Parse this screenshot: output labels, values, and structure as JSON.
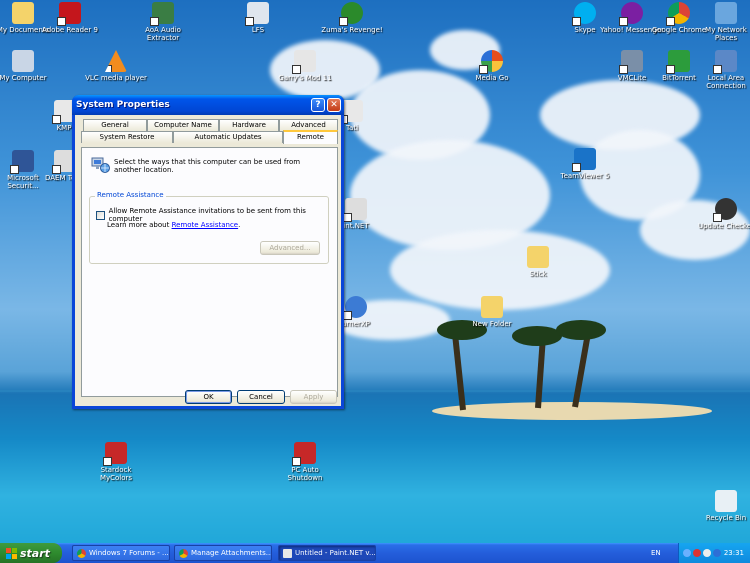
{
  "desktop": {
    "icons": [
      {
        "label": "My Documents",
        "icon": "folder-documents-icon",
        "color": "#f4d36a"
      },
      {
        "label": "Adobe Reader 9",
        "icon": "adobe-reader-icon",
        "color": "#c4161c"
      },
      {
        "label": "AoA Audio Extractor",
        "icon": "audio-extractor-icon",
        "color": "#3a7d44"
      },
      {
        "label": "LFS",
        "icon": "lfs-icon",
        "color": "#dfe6ee"
      },
      {
        "label": "Zuma's Revenge!",
        "icon": "zuma-icon",
        "color": "#2b8a2b"
      },
      {
        "label": "Skype",
        "icon": "skype-icon",
        "color": "#00aff0"
      },
      {
        "label": "Yahoo! Messenger",
        "icon": "yahoo-messenger-icon",
        "color": "#7b1fa2"
      },
      {
        "label": "Google Chrome",
        "icon": "chrome-icon",
        "color": "#4caf50"
      },
      {
        "label": "My Network Places",
        "icon": "network-places-icon",
        "color": "#6aa6de"
      },
      {
        "label": "My Computer",
        "icon": "computer-icon",
        "color": "#c9d6e6"
      },
      {
        "label": "VLC media player",
        "icon": "vlc-icon",
        "color": "#f28c1e"
      },
      {
        "label": "Garry's Mod 11",
        "icon": "garrys-mod-icon",
        "color": "#e6e6e6"
      },
      {
        "label": "Media Go",
        "icon": "media-go-icon",
        "color": "#e84e1c"
      },
      {
        "label": "VMCLite",
        "icon": "vmclite-icon",
        "color": "#7a8fa8"
      },
      {
        "label": "BitTorrent",
        "icon": "bittorrent-icon",
        "color": "#2c9c3c"
      },
      {
        "label": "Local Area Connection",
        "icon": "lan-icon",
        "color": "#5b88c7"
      },
      {
        "label": "KMPl",
        "icon": "kmplayer-icon",
        "color": "#e8e8e8"
      },
      {
        "label": "Tati",
        "icon": "tati-icon",
        "color": "#e8e8e8"
      },
      {
        "label": "Microsoft Securit...",
        "icon": "security-icon",
        "color": "#2f5597"
      },
      {
        "label": "DAEM Tools",
        "icon": "daemon-tools-icon",
        "color": "#ddd"
      },
      {
        "label": "TeamViewer 5",
        "icon": "teamviewer-icon",
        "color": "#1a73c8"
      },
      {
        "label": "Update Checker",
        "icon": "update-checker-icon",
        "color": "#333"
      },
      {
        "label": "int.NET",
        "icon": "paintnet-icon",
        "color": "#ddd"
      },
      {
        "label": "Stick",
        "icon": "folder-icon",
        "color": "#f4d36a"
      },
      {
        "label": "New Folder",
        "icon": "folder-icon",
        "color": "#f4d36a"
      },
      {
        "label": "urnerXP",
        "icon": "burnerxp-icon",
        "color": "#3c7bd4"
      },
      {
        "label": "Stardock MyColors",
        "icon": "stardock-icon",
        "color": "#c62828"
      },
      {
        "label": "PC Auto Shutdown",
        "icon": "shutdown-icon",
        "color": "#c62828"
      },
      {
        "label": "Recycle Bin",
        "icon": "recycle-bin-icon",
        "color": "#e8f0f5"
      }
    ]
  },
  "dialog": {
    "title": "System Properties",
    "help_label": "?",
    "close_label": "✕",
    "tabs_row1": [
      "General",
      "Computer Name",
      "Hardware",
      "Advanced"
    ],
    "tabs_row2": [
      "System Restore",
      "Automatic Updates",
      "Remote"
    ],
    "description": "Select the ways that this computer can be used from another location.",
    "group_title": "Remote Assistance",
    "checkbox_label": "Allow Remote Assistance invitations to be sent from this computer",
    "checkbox_checked": false,
    "learn_prefix": "Learn more about ",
    "learn_link": "Remote Assistance",
    "learn_suffix": ".",
    "advanced_label": "Advanced...",
    "ok_label": "OK",
    "cancel_label": "Cancel",
    "apply_label": "Apply"
  },
  "taskbar": {
    "start_label": "start",
    "tasks": [
      {
        "label": "Windows 7 Forums - ...",
        "icon": "chrome-icon"
      },
      {
        "label": "Manage Attachments...",
        "icon": "chrome-icon"
      },
      {
        "label": "Untitled - Paint.NET v...",
        "icon": "paintnet-icon"
      }
    ],
    "language": "EN",
    "time": "23:31"
  }
}
